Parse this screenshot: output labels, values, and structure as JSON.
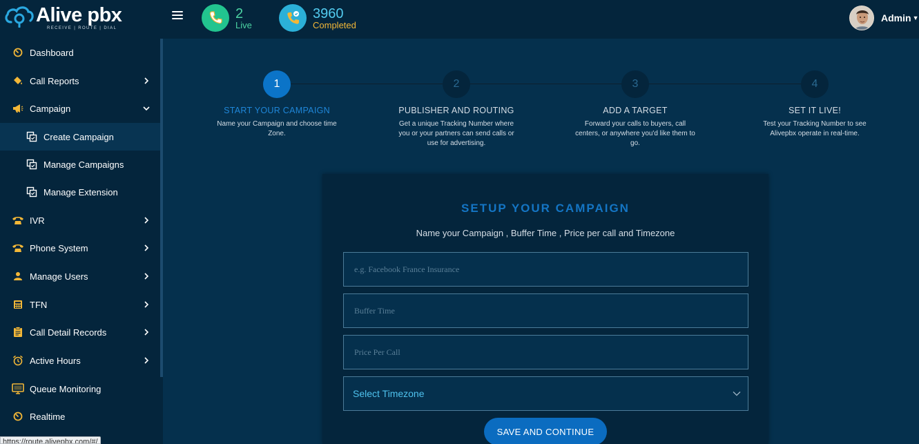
{
  "brand": {
    "name": "Alive pbx",
    "tagline": "RECEIVE | ROUTE | DIAL"
  },
  "header": {
    "live": {
      "count": "2",
      "label": "Live"
    },
    "completed": {
      "count": "3960",
      "label": "Completed"
    },
    "user": {
      "name": "Admin"
    }
  },
  "sidebar": {
    "items": [
      {
        "label": "Dashboard",
        "icon": "dashboard-gauge-icon"
      },
      {
        "label": "Call Reports",
        "icon": "paint-bucket-icon"
      },
      {
        "label": "Campaign",
        "icon": "megaphone-icon"
      },
      {
        "label": "Create Campaign",
        "icon": "copy-icon"
      },
      {
        "label": "Manage Campaigns",
        "icon": "copy-icon"
      },
      {
        "label": "Manage Extension",
        "icon": "copy-icon"
      },
      {
        "label": "IVR",
        "icon": "phone-icon"
      },
      {
        "label": "Phone System",
        "icon": "phone-icon"
      },
      {
        "label": "Manage Users",
        "icon": "user-icon"
      },
      {
        "label": "TFN",
        "icon": "calculator-icon"
      },
      {
        "label": "Call Detail Records",
        "icon": "clipboard-icon"
      },
      {
        "label": "Active Hours",
        "icon": "alarm-clock-icon"
      },
      {
        "label": "Queue Monitoring",
        "icon": "monitor-icon"
      },
      {
        "label": "Realtime",
        "icon": "dashboard-gauge-icon"
      }
    ]
  },
  "status_bar": {
    "url": "https://route.alivepbx.com/#/"
  },
  "steps": [
    {
      "num": "1",
      "title": "START YOUR CAMPAIGN",
      "desc": "Name your Campaign and choose time Zone."
    },
    {
      "num": "2",
      "title": "PUBLISHER AND ROUTING",
      "desc": "Get a unique Tracking Number where you or your partners can send calls or use for advertising."
    },
    {
      "num": "3",
      "title": "ADD A TARGET",
      "desc": "Forward your calls to buyers, call centers, or anywhere you'd like them to go."
    },
    {
      "num": "4",
      "title": "SET IT LIVE!",
      "desc": "Test your Tracking Number to see Alivepbx operate in real-time."
    }
  ],
  "form": {
    "title": "SETUP YOUR CAMPAIGN",
    "subtitle": "Name your Campaign , Buffer Time , Price per call and Timezone",
    "name_placeholder": "e.g. Facebook France Insurance",
    "buffer_placeholder": "Buffer Time",
    "price_placeholder": "Price Per Call",
    "timezone_selected": "Select Timezone",
    "submit_label": "SAVE AND CONTINUE"
  },
  "colors": {
    "page_bg": "#05304d",
    "panel_bg": "#04253c",
    "accent": "#0b74c8",
    "live": "#22c48f",
    "completed_count": "#52cbef",
    "completed_label": "#f3b737",
    "sidebar_icon": "#f3b737"
  }
}
